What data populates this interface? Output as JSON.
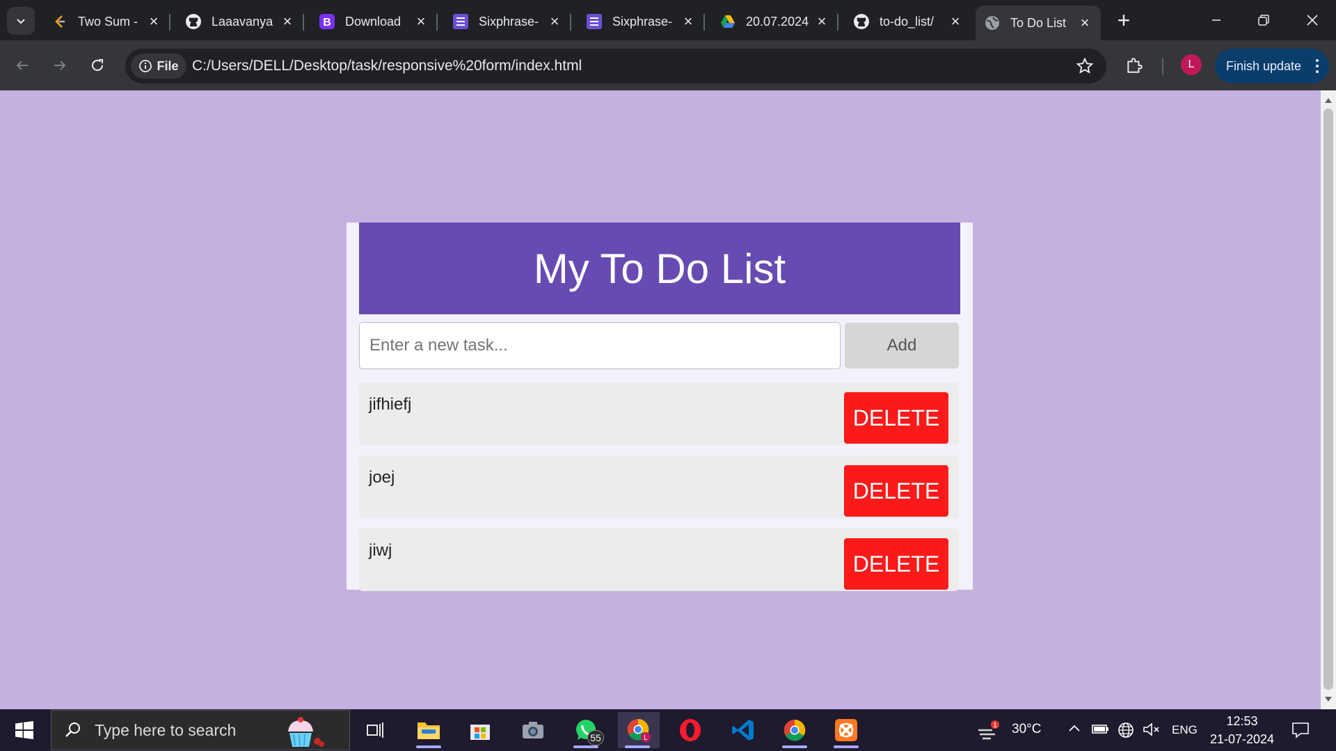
{
  "browser": {
    "tabs": [
      {
        "title": "Two Sum -",
        "icon": "leetcode-icon"
      },
      {
        "title": "Laaavanya",
        "icon": "github-icon"
      },
      {
        "title": "Download",
        "icon": "bootstrap-icon"
      },
      {
        "title": "Sixphrase-",
        "icon": "list-icon"
      },
      {
        "title": "Sixphrase-",
        "icon": "list-icon"
      },
      {
        "title": "20.07.2024",
        "icon": "drive-icon"
      },
      {
        "title": "to-do_list/",
        "icon": "github-icon"
      },
      {
        "title": "To Do List",
        "icon": "globe-icon"
      }
    ],
    "active_tab_index": 7,
    "site_info_label": "File",
    "url": "C:/Users/DELL/Desktop/task/responsive%20form/index.html",
    "profile_initial": "L",
    "update_button_label": "Finish update"
  },
  "page": {
    "title": "My To Do List",
    "input_placeholder": "Enter a new task...",
    "input_value": "",
    "add_button_label": "Add",
    "tasks": [
      {
        "text": "jifhiefj",
        "delete_label": "DELETE"
      },
      {
        "text": "joej",
        "delete_label": "DELETE"
      },
      {
        "text": "jiwj",
        "delete_label": "DELETE"
      }
    ],
    "colors": {
      "background": "#c5b0e0",
      "header": "#674bb2",
      "delete_button": "#fa1a1a"
    }
  },
  "taskbar": {
    "search_placeholder": "Type here to search",
    "whatsapp_badge": "55",
    "weather_alert_count": "1",
    "temperature": "30°C",
    "language": "ENG",
    "time": "12:53",
    "date": "21-07-2024"
  }
}
